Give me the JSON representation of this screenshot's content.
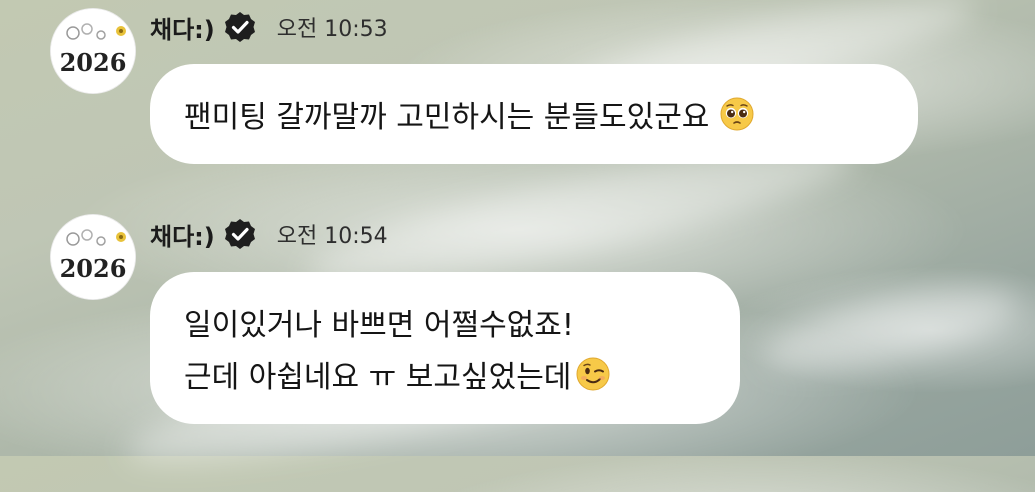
{
  "messages": [
    {
      "sender": "채다:)",
      "verified": true,
      "time": "오전 10:53",
      "avatar_text": "2026",
      "lines": [
        {
          "text": "팬미팅 갈까말까 고민하시는 분들도있군요",
          "emoji": "pleading-face-emoji"
        }
      ]
    },
    {
      "sender": "채다:)",
      "verified": true,
      "time": "오전 10:54",
      "avatar_text": "2026",
      "lines": [
        {
          "text": "일이있거나 바쁘면 어쩔수없죠!"
        },
        {
          "text": "근데 아쉽네요 ㅠ 보고싶었는데",
          "emoji": "winking-face-emoji"
        }
      ]
    }
  ]
}
